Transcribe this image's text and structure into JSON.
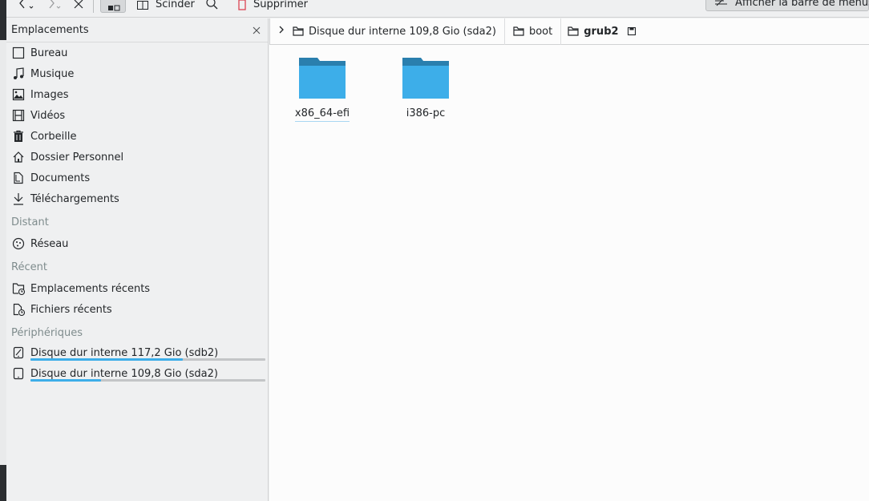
{
  "toolbar": {
    "split_label": "Scinder",
    "delete_label": "Supprimer",
    "menu_toggle_label": "Afficher la barre de menus"
  },
  "sidebar": {
    "title": "Emplacements",
    "places": [
      {
        "label": "Bureau",
        "icon": "desktop-icon"
      },
      {
        "label": "Musique",
        "icon": "music-icon"
      },
      {
        "label": "Images",
        "icon": "image-icon"
      },
      {
        "label": "Vidéos",
        "icon": "video-icon"
      },
      {
        "label": "Corbeille",
        "icon": "trash-icon"
      },
      {
        "label": "Dossier Personnel",
        "icon": "home-icon"
      },
      {
        "label": "Documents",
        "icon": "document-icon"
      },
      {
        "label": "Téléchargements",
        "icon": "download-icon"
      }
    ],
    "remote_title": "Distant",
    "remote": [
      {
        "label": "Réseau",
        "icon": "network-icon"
      }
    ],
    "recent_title": "Récent",
    "recent": [
      {
        "label": "Emplacements récents",
        "icon": "recent-folder-icon"
      },
      {
        "label": "Fichiers récents",
        "icon": "recent-file-icon"
      }
    ],
    "devices_title": "Périphériques",
    "devices": [
      {
        "label": "Disque dur interne 117,2 Gio (sdb2)",
        "icon": "drive-icon",
        "used_fraction": 0.65
      },
      {
        "label": "Disque dur interne 109,8 Gio (sda2)",
        "icon": "drive-icon",
        "used_fraction": 0.3
      }
    ]
  },
  "breadcrumb": {
    "items": [
      "Disque dur interne 109,8 Gio (sda2)",
      "boot",
      "grub2"
    ]
  },
  "files": [
    {
      "name": "x86_64-efi",
      "icon": "folder-icon",
      "selected": true
    },
    {
      "name": "i386-pc",
      "icon": "folder-icon",
      "selected": false
    }
  ],
  "colors": {
    "accent": "#3daee9",
    "folder_body": "#3daee9",
    "folder_tab": "#2a7fae"
  }
}
